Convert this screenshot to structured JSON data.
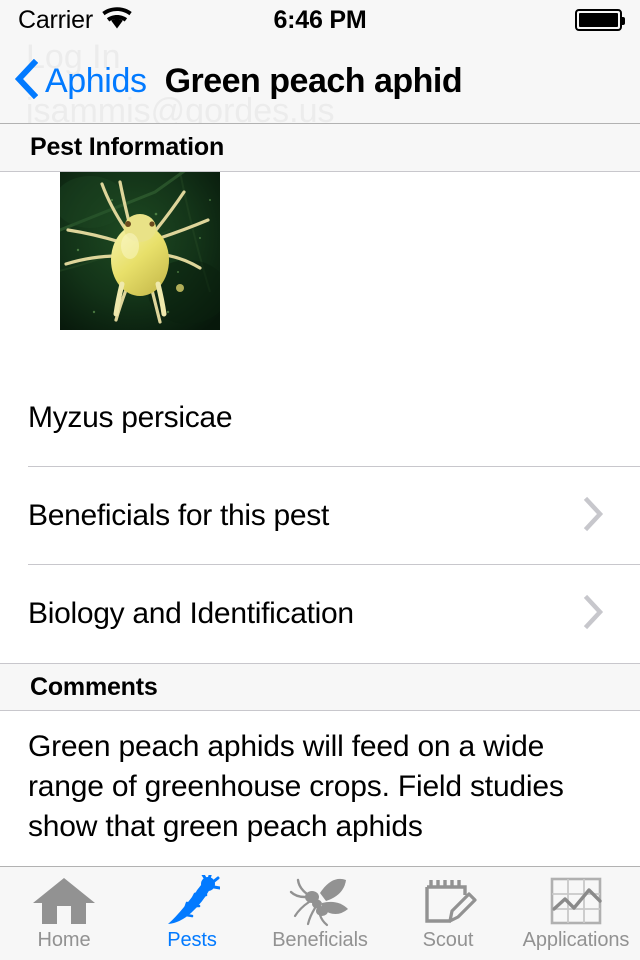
{
  "status_bar": {
    "carrier": "Carrier",
    "wifi_icon": "wifi-icon",
    "time": "6:46 PM",
    "battery_icon": "battery-full-icon"
  },
  "nav_bar": {
    "back_icon": "chevron-left-icon",
    "back_label": "Aphids",
    "title": "Green peach aphid",
    "ghost_line1": "Log In",
    "ghost_line2": "jsammis@gordes.us"
  },
  "sections": [
    {
      "header": "Pest Information",
      "photo": {
        "name": "green-peach-aphid-photo",
        "alt": "Green peach aphid on leaf"
      },
      "rows": [
        {
          "label": "Myzus persicae",
          "disclosure": false,
          "name": "pest-scientific-name-row"
        },
        {
          "label": "Beneficials for this pest",
          "disclosure": true,
          "name": "beneficials-for-this-pest-row"
        },
        {
          "label": "Biology and Identification",
          "disclosure": true,
          "name": "biology-and-identification-row"
        }
      ]
    },
    {
      "header": "Comments",
      "body": "Green peach aphids will feed on a wide range of greenhouse crops. Field studies show that green peach aphids"
    }
  ],
  "tab_bar": {
    "active_index": 1,
    "items": [
      {
        "label": "Home",
        "icon": "house-icon",
        "name": "tab-home"
      },
      {
        "label": "Pests",
        "icon": "caterpillar-icon",
        "name": "tab-pests"
      },
      {
        "label": "Beneficials",
        "icon": "wasp-icon",
        "name": "tab-beneficials"
      },
      {
        "label": "Scout",
        "icon": "notepad-pencil-icon",
        "name": "tab-scout"
      },
      {
        "label": "Applications",
        "icon": "line-chart-icon",
        "name": "tab-applications"
      }
    ]
  },
  "colors": {
    "accent": "#027aff",
    "inactive": "#929292",
    "separator": "#c8c7cc",
    "chrome_bg": "#f7f7f7",
    "ghost_text": "#ececec"
  }
}
